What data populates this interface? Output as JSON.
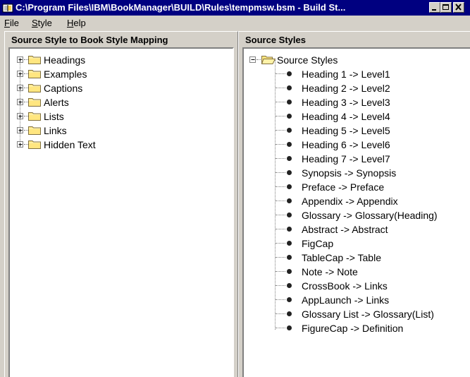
{
  "window": {
    "title": "C:\\Program Files\\IBM\\BookManager\\BUILD\\Rules\\tempmsw.bsm - Build St..."
  },
  "menu": {
    "items": [
      {
        "pre": "",
        "accel": "F",
        "post": "ile"
      },
      {
        "pre": "",
        "accel": "S",
        "post": "tyle"
      },
      {
        "pre": "",
        "accel": "H",
        "post": "elp"
      }
    ]
  },
  "left_panel": {
    "title": "Source Style to Book Style Mapping",
    "items": [
      "Headings",
      "Examples",
      "Captions",
      "Alerts",
      "Lists",
      "Links",
      "Hidden Text"
    ]
  },
  "right_panel": {
    "title": "Source Styles",
    "root": "Source Styles",
    "items": [
      "Heading 1 -> Level1",
      "Heading 2 -> Level2",
      "Heading 3 -> Level3",
      "Heading 4 -> Level4",
      "Heading 5 -> Level5",
      "Heading 6 -> Level6",
      "Heading 7 -> Level7",
      "Synopsis -> Synopsis",
      "Preface -> Preface",
      "Appendix -> Appendix",
      "Glossary -> Glossary(Heading)",
      "Abstract -> Abstract",
      "FigCap",
      "TableCap -> Table",
      "Note -> Note",
      "CrossBook -> Links",
      "AppLaunch -> Links",
      "Glossary List -> Glossary(List)",
      "FigureCap -> Definition"
    ]
  },
  "colors": {
    "titlebar": "#000080",
    "folder": "#ffe680",
    "face": "#d4d0c8"
  }
}
